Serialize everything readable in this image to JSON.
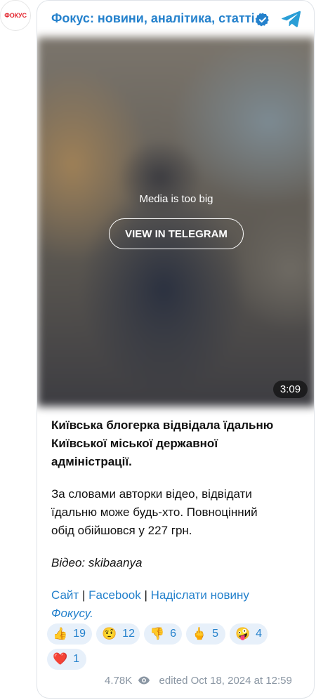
{
  "avatar": {
    "text": "ФОКУС",
    "color": "#e3262f"
  },
  "header": {
    "title": "Фокус: новини, аналітика, статті",
    "verified_icon": "verified-badge-icon",
    "logo_icon": "telegram-logo-icon",
    "accent_color": "#2481cc"
  },
  "media": {
    "notice": "Media is too big",
    "button_label": "VIEW IN TELEGRAM",
    "duration": "3:09"
  },
  "post": {
    "headline_line1": "Київська блогерка відвідала їдальню",
    "headline_line2": "Київської міської державної",
    "headline_line3": "адміністрації.",
    "body_line1": "За словами авторки відео, відвідати",
    "body_line2": "їдальню може будь-хто. Повноцінний",
    "body_line3": "обід обійшовся у 227 грн.",
    "credit": "Відео: skibaanya",
    "links": {
      "site": "Сайт",
      "sep1": "|",
      "facebook": "Facebook",
      "sep2": "|",
      "submit_news": "Надіслати новину",
      "submit_news_italic": "Фокусу."
    }
  },
  "reactions": [
    {
      "emoji": "👍",
      "count": "19"
    },
    {
      "emoji": "🤨",
      "count": "12"
    },
    {
      "emoji": "👎",
      "count": "6"
    },
    {
      "emoji": "🖕",
      "count": "5"
    },
    {
      "emoji": "🤪",
      "count": "4"
    },
    {
      "emoji": "❤️",
      "count": "1"
    }
  ],
  "footer": {
    "views": "4.78K",
    "views_icon": "eye-icon",
    "edited_label": "edited",
    "date": "Oct 18, 2024 at 12:59"
  }
}
